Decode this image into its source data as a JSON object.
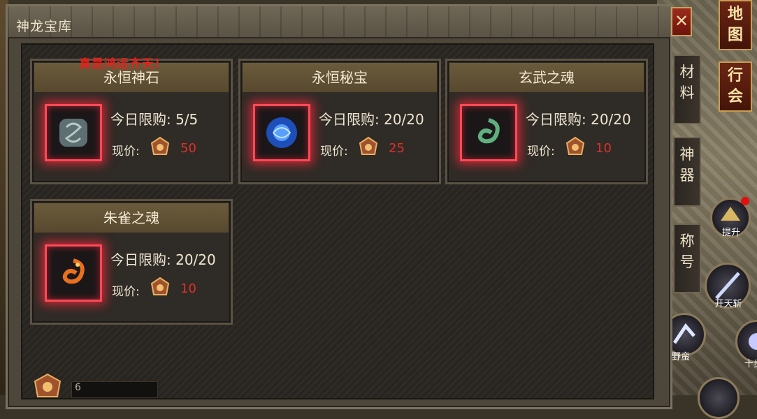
{
  "window": {
    "title": "神龙宝库",
    "close_label": "✕"
  },
  "banner": "真是鸿运齐天！",
  "side_tabs": [
    {
      "label": "材料"
    },
    {
      "label": "神器"
    },
    {
      "label": "称号"
    }
  ],
  "menu_buttons": [
    {
      "label": "地图"
    },
    {
      "label": "行会"
    }
  ],
  "skill_buttons": {
    "upgrade": "提升",
    "kaitian": "开天斩",
    "partial_left": "野蛮",
    "partial_right": "十步"
  },
  "price_label": "现价:",
  "items": [
    {
      "name": "永恒神石",
      "limit": "今日限购: 5/5",
      "price": "50",
      "icon": "rune-stone-icon",
      "color": "#7a8f92"
    },
    {
      "name": "永恒秘宝",
      "limit": "今日限购: 20/20",
      "price": "25",
      "icon": "blue-orb-icon",
      "color": "#2f6fe0"
    },
    {
      "name": "玄武之魂",
      "limit": "今日限购: 20/20",
      "price": "10",
      "icon": "green-serpent-icon",
      "color": "#4d9a6a"
    },
    {
      "name": "朱雀之魂",
      "limit": "今日限购: 20/20",
      "price": "10",
      "icon": "orange-phoenix-icon",
      "color": "#e26a1c"
    }
  ],
  "currency": {
    "amount": "6",
    "icon": "treasure-coin-icon"
  }
}
